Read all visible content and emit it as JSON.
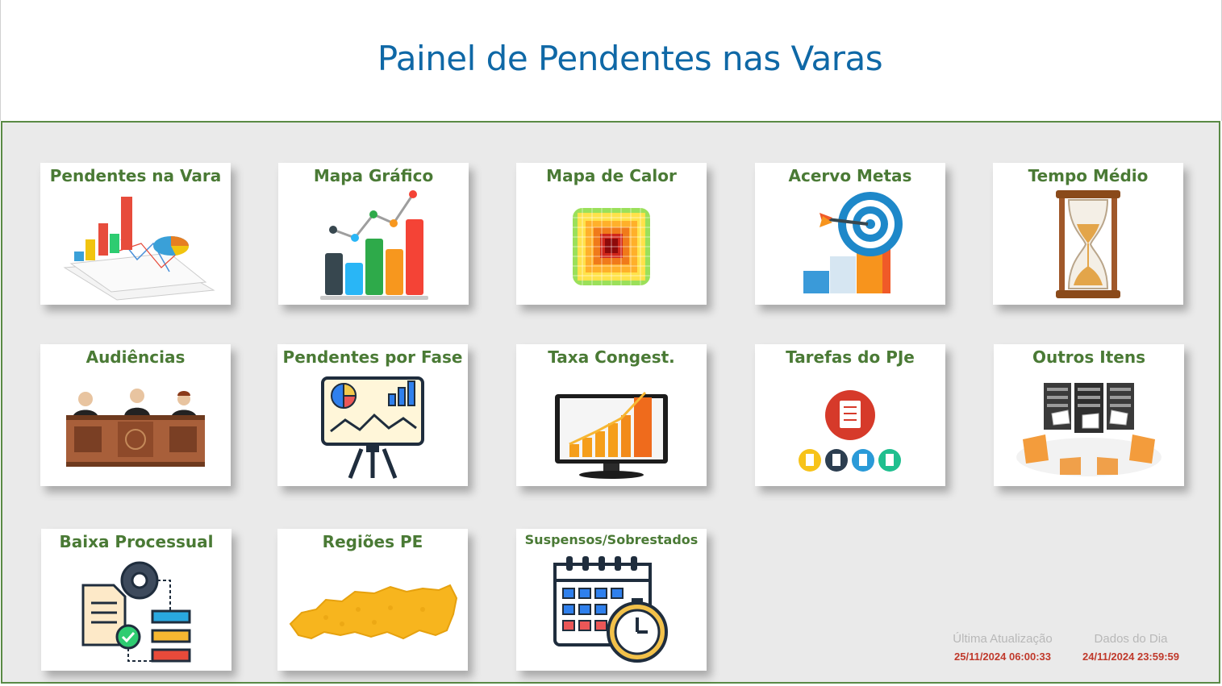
{
  "page": {
    "title": "Painel de Pendentes nas Varas"
  },
  "tiles": [
    {
      "label": "Pendentes na Vara",
      "icon": "charts-report-icon"
    },
    {
      "label": "Mapa Gráfico",
      "icon": "bar-line-chart-icon"
    },
    {
      "label": "Mapa de Calor",
      "icon": "heatmap-icon"
    },
    {
      "label": "Acervo Metas",
      "icon": "target-bars-icon"
    },
    {
      "label": "Tempo Médio",
      "icon": "hourglass-icon"
    },
    {
      "label": "Audiências",
      "icon": "court-judges-icon"
    },
    {
      "label": "Pendentes por Fase",
      "icon": "presentation-board-icon"
    },
    {
      "label": "Taxa Congest.",
      "icon": "monitor-chart-icon"
    },
    {
      "label": "Tarefas do PJe",
      "icon": "task-list-icon"
    },
    {
      "label": "Outros Itens",
      "icon": "server-files-icon"
    },
    {
      "label": "Baixa Processual",
      "icon": "process-flow-icon"
    },
    {
      "label": "Regiões PE",
      "icon": "pernambuco-map-icon"
    },
    {
      "label": "Suspensos/Sobrestados",
      "icon": "calendar-clock-icon"
    }
  ],
  "footer": {
    "last_update_label": "Última Atualização",
    "last_update_value": "25/11/2024 06:00:33",
    "data_day_label": "Dados do Dia",
    "data_day_value": "24/11/2024 23:59:59"
  },
  "colors": {
    "title": "#0f68a6",
    "tile_label": "#4a7a35",
    "panel_border": "#5a8a45",
    "panel_bg": "#eaeaea",
    "footer_value": "#c0392b"
  }
}
